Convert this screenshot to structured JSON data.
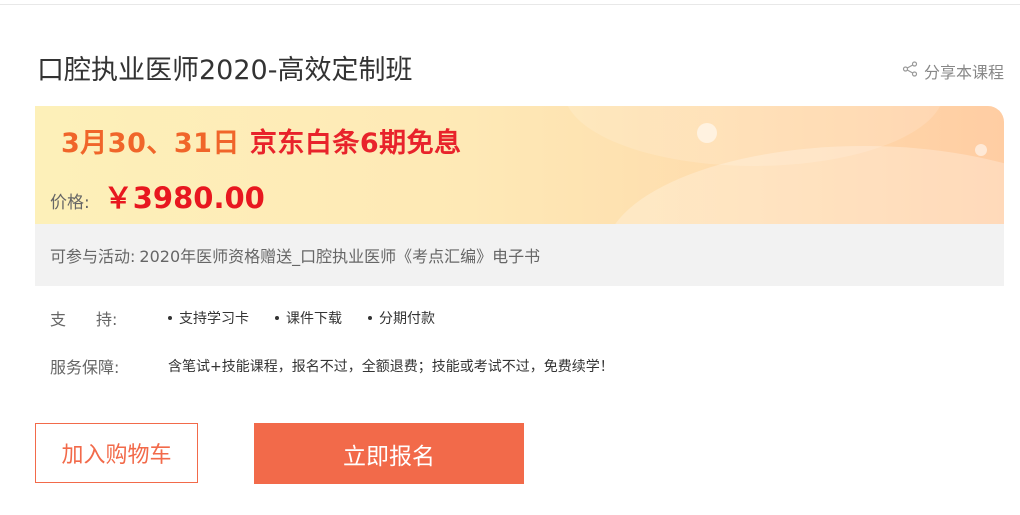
{
  "course": {
    "title": "口腔执业医师2020-高效定制班",
    "share_label": "分享本课程"
  },
  "promo": {
    "date_text": "3月30、31日",
    "offer_text": "京东白条6期免息",
    "price_label": "价格:",
    "price_value": "￥3980.00",
    "date_color": "#f0652a",
    "offer_color": "#e8232b",
    "price_color": "#e8171f"
  },
  "activity": {
    "label": "可参与活动:",
    "text": "2020年医师资格赠送_口腔执业医师《考点汇编》电子书"
  },
  "support": {
    "label_a": "支",
    "label_b": "持:",
    "items": [
      "支持学习卡",
      "课件下载",
      "分期付款"
    ]
  },
  "guarantee": {
    "label": "服务保障:",
    "text": "含笔试+技能课程，报名不过，全额退费；技能或考试不过，免费续学！"
  },
  "buttons": {
    "cart_label": "加入购物车",
    "enroll_label": "立即报名",
    "accent_color": "#f26a4a"
  },
  "icons": {
    "share": "share-icon"
  }
}
